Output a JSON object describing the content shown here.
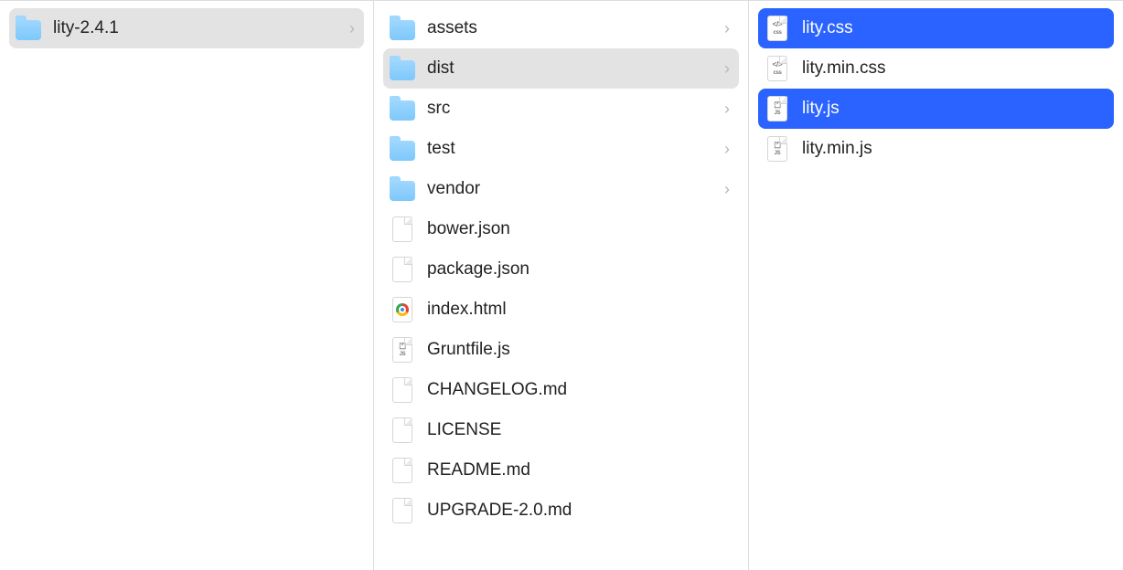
{
  "columns": [
    {
      "items": [
        {
          "name": "lity-2.4.1",
          "type": "folder",
          "has_children": true,
          "active": true,
          "selected": false
        }
      ]
    },
    {
      "items": [
        {
          "name": "assets",
          "type": "folder",
          "has_children": true,
          "active": false,
          "selected": false
        },
        {
          "name": "dist",
          "type": "folder",
          "has_children": true,
          "active": true,
          "selected": false
        },
        {
          "name": "src",
          "type": "folder",
          "has_children": true,
          "active": false,
          "selected": false
        },
        {
          "name": "test",
          "type": "folder",
          "has_children": true,
          "active": false,
          "selected": false
        },
        {
          "name": "vendor",
          "type": "folder",
          "has_children": true,
          "active": false,
          "selected": false
        },
        {
          "name": "bower.json",
          "type": "file",
          "has_children": false,
          "active": false,
          "selected": false
        },
        {
          "name": "package.json",
          "type": "file",
          "has_children": false,
          "active": false,
          "selected": false
        },
        {
          "name": "index.html",
          "type": "html",
          "has_children": false,
          "active": false,
          "selected": false
        },
        {
          "name": "Gruntfile.js",
          "type": "js",
          "has_children": false,
          "active": false,
          "selected": false
        },
        {
          "name": "CHANGELOG.md",
          "type": "file",
          "has_children": false,
          "active": false,
          "selected": false
        },
        {
          "name": "LICENSE",
          "type": "file",
          "has_children": false,
          "active": false,
          "selected": false
        },
        {
          "name": "README.md",
          "type": "file",
          "has_children": false,
          "active": false,
          "selected": false
        },
        {
          "name": "UPGRADE-2.0.md",
          "type": "file",
          "has_children": false,
          "active": false,
          "selected": false
        }
      ]
    },
    {
      "items": [
        {
          "name": "lity.css",
          "type": "css",
          "has_children": false,
          "active": false,
          "selected": true
        },
        {
          "name": "lity.min.css",
          "type": "css",
          "has_children": false,
          "active": false,
          "selected": false
        },
        {
          "name": "lity.js",
          "type": "js",
          "has_children": false,
          "active": false,
          "selected": true
        },
        {
          "name": "lity.min.js",
          "type": "js",
          "has_children": false,
          "active": false,
          "selected": false
        }
      ]
    }
  ]
}
